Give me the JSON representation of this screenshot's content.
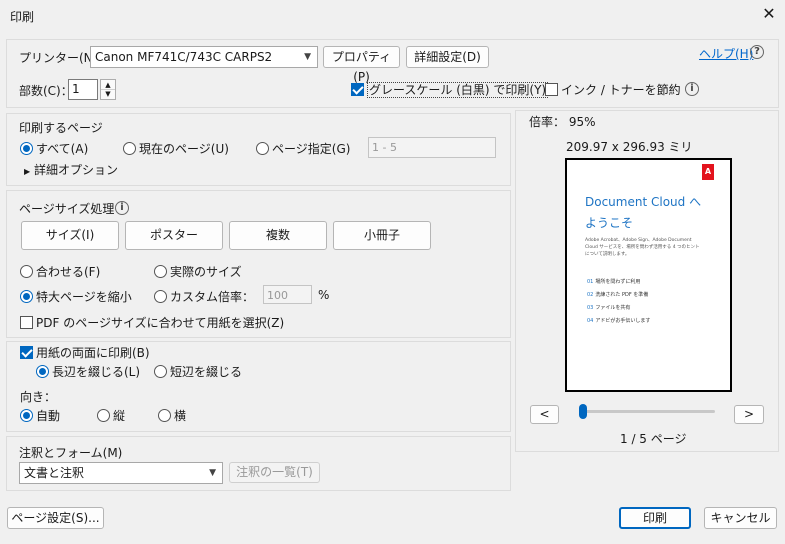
{
  "window": {
    "title": "印刷",
    "close_glyph": "✕"
  },
  "printer": {
    "label": "プリンター(N)：",
    "selected": "Canon MF741C/743C CARPS2",
    "properties_button": "プロパティ(P)",
    "advanced_button": "詳細設定(D)",
    "help_link": "ヘルプ(H)",
    "help_icon": "?",
    "copies_label": "部数(C)：",
    "copies_value": "1",
    "grayscale_label": "グレースケール (白黒) で印刷(Y)",
    "grayscale_checked": true,
    "save_ink_label": "インク / トナーを節約",
    "save_ink_checked": false,
    "info_icon": "i"
  },
  "pages": {
    "heading": "印刷するページ",
    "all_label": "すべて(A)",
    "current_label": "現在のページ(U)",
    "range_label": "ページ指定(G)",
    "range_placeholder": "1 - 5",
    "more_options": "詳細オプション",
    "selected": "all"
  },
  "page_size": {
    "heading": "ページサイズ処理",
    "info_icon": "i",
    "buttons": [
      "サイズ(I)",
      "ポスター",
      "複数",
      "小冊子"
    ],
    "fit_label": "合わせる(F)",
    "actual_label": "実際のサイズ",
    "shrink_label": "特大ページを縮小",
    "custom_label": "カスタム倍率：",
    "custom_value": "100",
    "custom_unit": "%",
    "selected": "shrink",
    "choose_paper_label": "PDF のページサイズに合わせて用紙を選択(Z)",
    "choose_paper_checked": false
  },
  "duplex": {
    "label": "用紙の両面に印刷(B)",
    "checked": true,
    "long_edge_label": "長辺を綴じる(L)",
    "short_edge_label": "短辺を綴じる",
    "selected": "long"
  },
  "orientation": {
    "heading": "向き：",
    "auto_label": "自動",
    "portrait_label": "縦",
    "landscape_label": "横",
    "selected": "auto"
  },
  "comments": {
    "heading": "注釈とフォーム(M)",
    "selected": "文書と注釈",
    "summary_button": "注釈の一覧(T)"
  },
  "preview": {
    "scale_text": "倍率： 95%",
    "dimensions_text": "209.97 x 296.93 ミリ",
    "page_indicator": "1 / 5 ページ",
    "prev_button": "<",
    "next_button": ">",
    "slider_fraction": 0,
    "document": {
      "logo_glyph": "A",
      "title_line1": "Document Cloud へ",
      "title_line2": "ようこそ",
      "intro": "Adobe Acrobat、Adobe Sign、Adobe Document Cloud サービスを、場所を問わず活用する 4 つのヒントについて説明します。",
      "items": [
        {
          "num": "01",
          "text": "場所を問わずに利用"
        },
        {
          "num": "02",
          "text": "洗練された PDF を準備"
        },
        {
          "num": "03",
          "text": "ファイルを共有"
        },
        {
          "num": "04",
          "text": "アドビがお手伝いします"
        }
      ]
    }
  },
  "footer": {
    "page_setup_button": "ページ設定(S)...",
    "print_button": "印刷",
    "cancel_button": "キャンセル"
  },
  "colors": {
    "accent": "#0067c0",
    "doc_blue": "#1e74c4",
    "adobe_red": "#e3131d"
  }
}
